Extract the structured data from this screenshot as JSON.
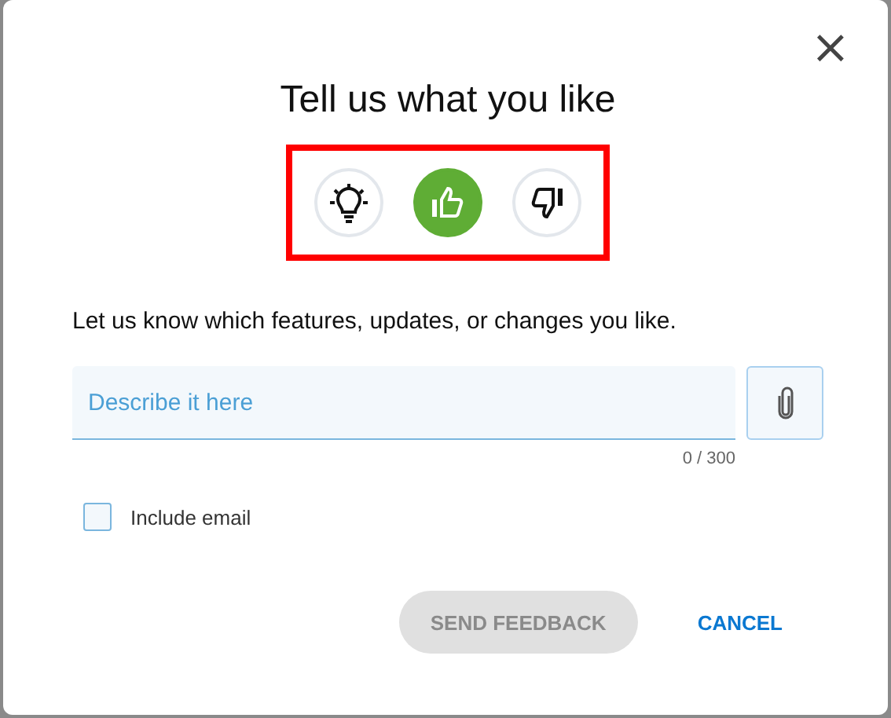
{
  "dialog": {
    "title": "Tell us what you like",
    "close": "×"
  },
  "reactions": [
    {
      "kind": "idea",
      "selected": false
    },
    {
      "kind": "like",
      "selected": true
    },
    {
      "kind": "dislike",
      "selected": false
    }
  ],
  "prompt": "Let us know which features, updates, or changes you like.",
  "field": {
    "placeholder": "Describe it here",
    "counter": "0 / 300"
  },
  "include_email": {
    "label": "Include email",
    "checked": false
  },
  "buttons": [
    {
      "label": "SEND FEEDBACK",
      "kind": "primary",
      "disabled": true
    },
    {
      "label": "CANCEL",
      "kind": "text",
      "disabled": false
    }
  ]
}
